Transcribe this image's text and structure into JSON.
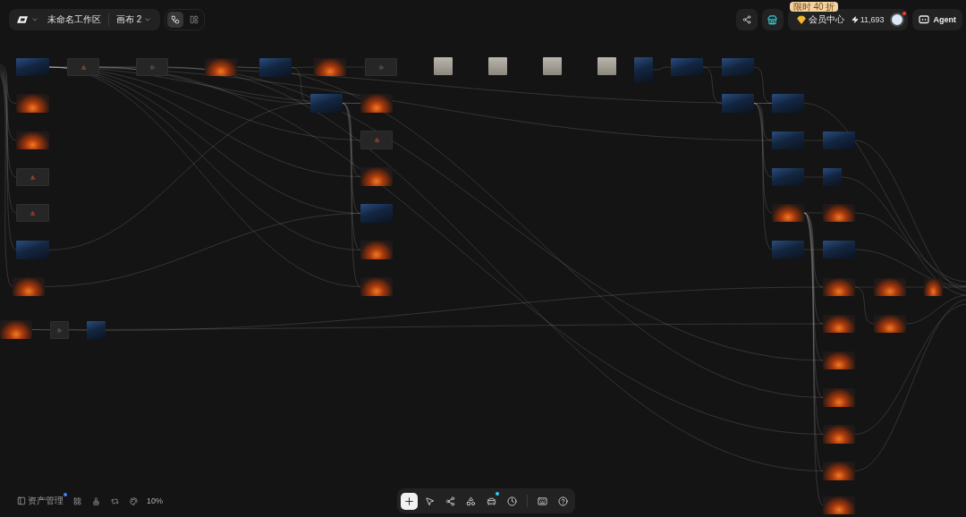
{
  "workspace": {
    "name": "未命名工作区",
    "canvas_name": "画布 2"
  },
  "view_modes": [
    {
      "kind": "workflow",
      "selected": true
    },
    {
      "kind": "panel",
      "selected": false
    }
  ],
  "account": {
    "promo": "限时 40 折",
    "member_label": "会员中心",
    "credits": "11,693",
    "notification": true
  },
  "agent": {
    "label": "Agent"
  },
  "canvas": {
    "nodes": [
      {
        "kind": "night"
      },
      {
        "kind": "failed"
      },
      {
        "kind": "pending"
      },
      {
        "kind": "fire"
      },
      {
        "kind": "night"
      },
      {
        "kind": "fire"
      },
      {
        "kind": "pending"
      },
      {
        "kind": "portrait"
      },
      {
        "kind": "portrait"
      },
      {
        "kind": "portrait"
      },
      {
        "kind": "portrait"
      },
      {
        "kind": "night"
      },
      {
        "kind": "night"
      },
      {
        "kind": "night"
      },
      {
        "kind": "fire"
      },
      {
        "kind": "night"
      },
      {
        "kind": "fire"
      },
      {
        "kind": "night"
      },
      {
        "kind": "night"
      },
      {
        "kind": "fire"
      },
      {
        "kind": "failed"
      },
      {
        "kind": "night"
      },
      {
        "kind": "night"
      },
      {
        "kind": "failed"
      },
      {
        "kind": "fire"
      },
      {
        "kind": "night"
      },
      {
        "kind": "night"
      },
      {
        "kind": "failed"
      },
      {
        "kind": "night"
      },
      {
        "kind": "fire"
      },
      {
        "kind": "fire"
      },
      {
        "kind": "night"
      },
      {
        "kind": "fire"
      },
      {
        "kind": "night"
      },
      {
        "kind": "night"
      },
      {
        "kind": "fire"
      },
      {
        "kind": "fire"
      },
      {
        "kind": "fire"
      },
      {
        "kind": "fire"
      },
      {
        "kind": "fire"
      },
      {
        "kind": "fire"
      },
      {
        "kind": "fire"
      },
      {
        "kind": "fire"
      },
      {
        "kind": "pending"
      },
      {
        "kind": "night"
      },
      {
        "kind": "fire"
      },
      {
        "kind": "fire"
      },
      {
        "kind": "fire"
      },
      {
        "kind": "fire"
      },
      {
        "kind": "fire"
      }
    ]
  },
  "assets": {
    "label": "资产管理",
    "badge": true
  },
  "zoom": "10%",
  "toolbar": {
    "tools": [
      {
        "kind": "add",
        "selected": true,
        "badge": false
      },
      {
        "kind": "select",
        "selected": false,
        "badge": false
      },
      {
        "kind": "connect",
        "selected": false,
        "badge": false
      },
      {
        "kind": "shapes",
        "selected": false,
        "badge": false
      },
      {
        "kind": "vehicle",
        "selected": false,
        "badge": true
      },
      {
        "kind": "history",
        "selected": false,
        "badge": false
      }
    ],
    "extras": [
      {
        "kind": "keyboard"
      },
      {
        "kind": "help"
      }
    ]
  }
}
